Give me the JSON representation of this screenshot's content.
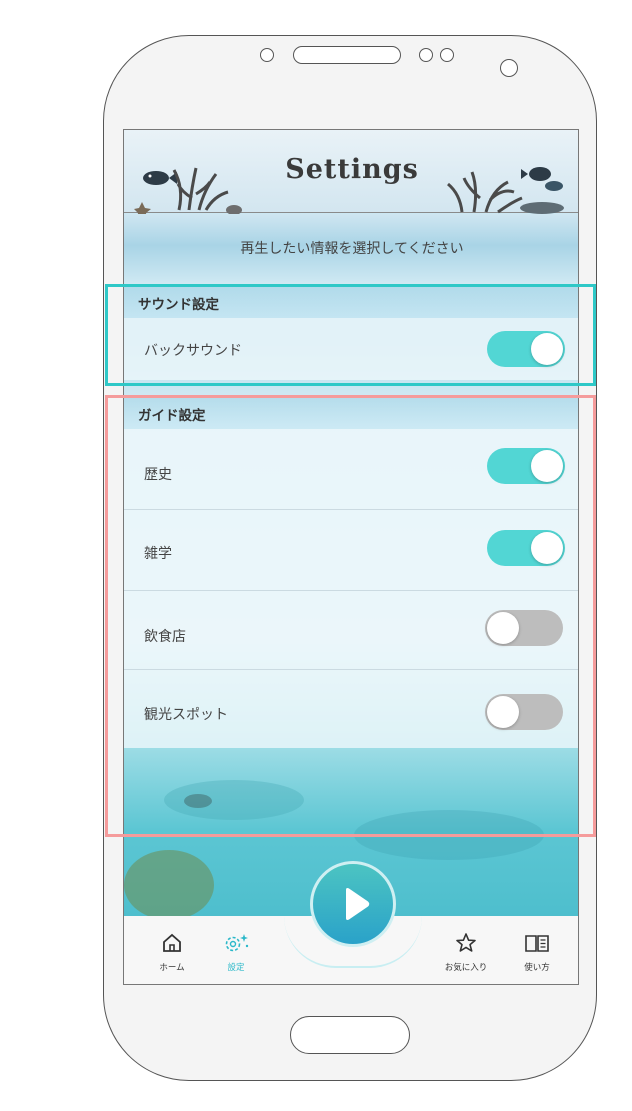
{
  "header": {
    "title": "Settings"
  },
  "instruction": "再生したい情報を選択してください",
  "sections": {
    "sound": {
      "label": "サウンド設定",
      "items": [
        {
          "label": "バックサウンド",
          "enabled": true
        }
      ]
    },
    "guide": {
      "label": "ガイド設定",
      "items": [
        {
          "label": "歴史",
          "enabled": true
        },
        {
          "label": "雑学",
          "enabled": true
        },
        {
          "label": "飲食店",
          "enabled": false
        },
        {
          "label": "観光スポット",
          "enabled": false
        }
      ]
    }
  },
  "tabbar": {
    "home": "ホーム",
    "settings": "設定",
    "favorites": "お気に入り",
    "howto": "使い方",
    "active": "settings"
  },
  "icons": {
    "play": "play-icon",
    "home": "home-icon",
    "settings": "gear-icon",
    "favorites": "star-icon",
    "howto": "book-icon"
  },
  "colors": {
    "toggle_on": "#52d6d4",
    "toggle_off": "#bdbdbd",
    "highlight_sound": "#2ec8c7",
    "highlight_guide": "#f59b9b",
    "active_tab": "#2bb8c9"
  }
}
